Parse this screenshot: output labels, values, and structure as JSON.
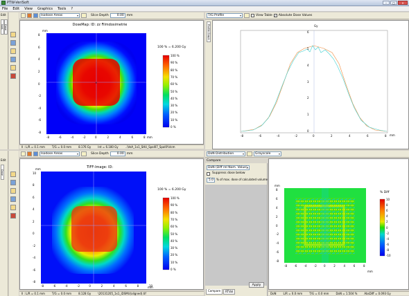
{
  "app": {
    "title": "PTW-VeriSoft"
  },
  "menu": [
    "File",
    "Edit",
    "View",
    "Graphics",
    "Tools",
    "?"
  ],
  "window_buttons": {
    "min": "–",
    "max": "□",
    "close": "✕"
  },
  "side_labels": {
    "edit_top": "Edit",
    "edit_bottom": "Edit",
    "tab1": "Isod.",
    "tab2": "Dose",
    "tab3": "Dose"
  },
  "top_left": {
    "display_mode": "Isodose Areas",
    "slice_label": "Slice Depth",
    "slice_value": "0.00",
    "slice_unit": "mm",
    "plot_title": "DoseMap: ID: zz Filmdosimetrie",
    "colorbar_header": "100 % = 6.200 Gy",
    "colorbar_labels": [
      "100 %",
      "90 %",
      "80 %",
      "70 %",
      "60 %",
      "50 %",
      "40 %",
      "30 %",
      "20 %",
      "10 %",
      "0 %"
    ],
    "x_ticks": [
      "-8",
      "-6",
      "-4",
      "-2",
      "0",
      "2",
      "4",
      "6",
      "8"
    ],
    "y_ticks": [
      "8",
      "6",
      "4",
      "2",
      "0",
      "-2",
      "-4",
      "-6",
      "-8"
    ],
    "axis_unit_y": "mm",
    "axis_unit_x": "mm",
    "status": [
      "Il : L/R = 0.1 mm",
      "T/G = 0.0 mm",
      "8.176 Gy",
      "Int = 6.180 Gy",
      "..\\VeA_1x1_SHU_Spal07_Spal0Y.dcm"
    ]
  },
  "top_right": {
    "profile_mode": "T/G Profile",
    "view_table": "View Table",
    "absolute_dose": "Absolute Dose Values",
    "side_tab": "Profile Graph",
    "y_unit": "Gy",
    "x_unit": "mm",
    "y_ticks": [
      "6",
      "5",
      "4",
      "3",
      "2",
      "1",
      "0"
    ],
    "x_ticks": [
      "-8",
      "-6",
      "-4",
      "-2",
      "0",
      "2",
      "4",
      "6",
      "8"
    ],
    "colors": {
      "measured": "#3fd0d0",
      "calculated": "#f08a3a"
    }
  },
  "bottom_left": {
    "display_mode": "Isodose Areas",
    "slice_label": "Slice Depth",
    "slice_value": "0.00",
    "slice_unit": "mm",
    "plot_title": "TIFF-Image: ID:",
    "colorbar_header": "100 % = 6.200 Gy",
    "colorbar_labels": [
      "100 %",
      "90 %",
      "80 %",
      "70 %",
      "60 %",
      "50 %",
      "40 %",
      "30 %",
      "20 %",
      "10 %",
      "0 %"
    ],
    "x_ticks": [
      "-8",
      "-6",
      "-4",
      "-2",
      "0",
      "2",
      "4",
      "6",
      "8",
      "10"
    ],
    "y_ticks": [
      "10",
      "8",
      "6",
      "4",
      "2",
      "0",
      "-2",
      "-4",
      "-6",
      "-8"
    ],
    "axis_unit_y": "mm",
    "axis_unit_x": "mm",
    "status": [
      "Il : L/R = 0.1 mm",
      "T/G = 0.0 mm",
      "8.128 Gy",
      "\\20131205_1x1_iDSMU(aligned).tif"
    ]
  },
  "compare": {
    "mode": "DoN Distribution",
    "colorscale": "Grayscale",
    "header": "Compare",
    "distribution": "DoN (Diff rel Nom. Value)",
    "suppress_label": "Suppress dose below",
    "suppress_value": "5.0",
    "suppress_text": "% of max. dose of calculated volume",
    "apply": "Apply",
    "tabs": [
      "Compare",
      "RTVal"
    ]
  },
  "bottom_right": {
    "colorbar_title": "% Diff",
    "colorbar_labels": [
      "10",
      "8",
      "6",
      "4",
      "2",
      "0",
      "-2",
      "-4",
      "-6",
      "-8",
      "-10"
    ],
    "x_ticks": [
      "-8",
      "-6",
      "-4",
      "-2",
      "0",
      "2",
      "4",
      "6",
      "8"
    ],
    "y_ticks": [
      "8",
      "6",
      "4",
      "2",
      "0",
      "-2",
      "-4",
      "-6",
      "-8"
    ],
    "axis_unit_y": "mm",
    "axis_unit_x": "mm",
    "status": [
      "DoN",
      "L/R = 0.0 mm",
      "T/G = 0.0 mm",
      "DoN = 1.504 %",
      "AbsDiff = 0.093 Gy"
    ]
  }
}
